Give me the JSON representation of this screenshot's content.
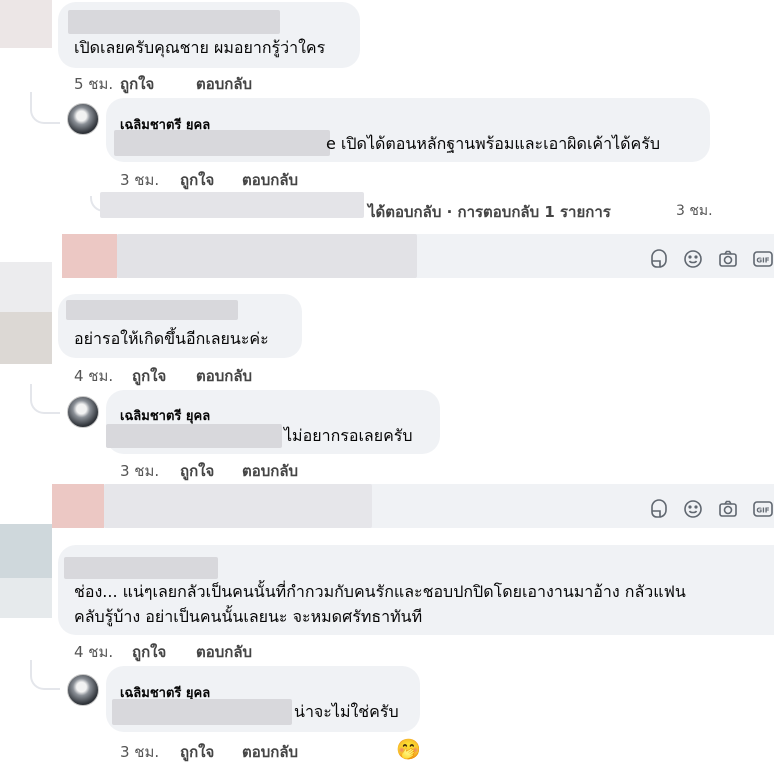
{
  "comments": [
    {
      "text": "เปิดเลยครับคุณชาย ผมอยากรู้ว่าใคร",
      "time": "5 ชม.",
      "like": "ถูกใจ",
      "reply": "ตอบกลับ",
      "replies": [
        {
          "author": "เฉลิมชาตรี ยุคล",
          "text": "e เปิดได้ตอนหลักฐานพร้อมและเอาผิดเค้าได้ครับ",
          "time": "3 ชม.",
          "like": "ถูกใจ",
          "reply": "ตอบกลับ"
        }
      ],
      "more_replies": {
        "label": "ได้ตอบกลับ · การตอบกลับ 1 รายการ",
        "time": "3 ชม."
      }
    },
    {
      "text": "อย่ารอให้เกิดขึ้นอีกเลยนะค่ะ",
      "time": "4 ชม.",
      "like": "ถูกใจ",
      "reply": "ตอบกลับ",
      "replies": [
        {
          "author": "เฉลิมชาตรี ยุคล",
          "text": "ไม่อยากรอเลยครับ",
          "time": "3 ชม.",
          "like": "ถูกใจ",
          "reply": "ตอบกลับ"
        }
      ]
    },
    {
      "text_line1": "ช่อง... แน่ๆเลยกลัวเป็นคนนั้นที่กำกวมกับคนรักและชอบปกปิดโดยเอางานมาอ้าง กลัวแฟน",
      "text_line2": "คลับรู้บ้าง อย่าเป็นคนนั้นเลยนะ จะหมดศรัทธาทันที",
      "time": "4 ชม.",
      "like": "ถูกใจ",
      "reply": "ตอบกลับ",
      "replies": [
        {
          "author": "เฉลิมชาตรี ยุคล",
          "text": "น่าจะไม่ใช่ครับ",
          "time": "3 ชม.",
          "like": "ถูกใจ",
          "reply": "ตอบกลับ",
          "reaction": "🤭"
        }
      ]
    }
  ],
  "input_icons": [
    "sticker-icon",
    "emoji-icon",
    "camera-icon",
    "gif-icon"
  ],
  "gif_label": "GIF"
}
